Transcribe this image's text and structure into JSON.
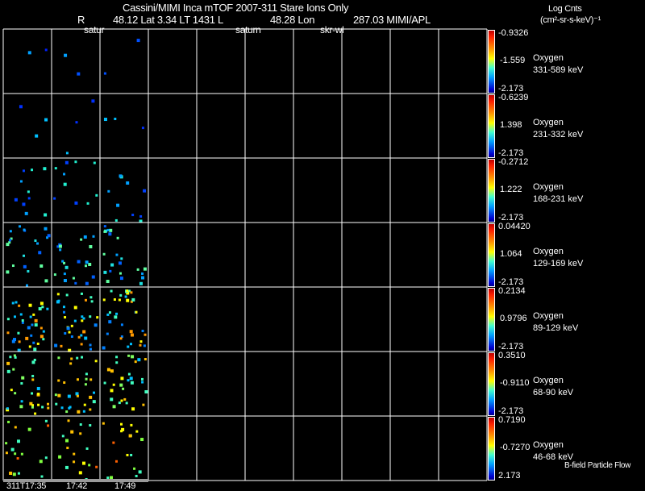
{
  "header": {
    "title": "Cassini/MIMI Inca mTOF  2007-311    Stare    Ions Only",
    "r_label": "R",
    "r_value": "48.12 Lat 3.34 LT 1431 L",
    "l_value": "48.28 Lon",
    "lon_value": "287.03  MIMI/APL",
    "markers": [
      "satur",
      "saturn",
      "skr-wl"
    ],
    "units_title": "Log Cnts",
    "units": "(cm²-sr-s-keV)⁻¹"
  },
  "chart_data": {
    "type": "heatmap",
    "title": "Cassini/MIMI Inca mTOF 2007-311 Stare Ions Only",
    "x_ticks": [
      "311T17:35",
      "17:42",
      "17:49"
    ],
    "panels": [
      {
        "species": "Oxygen",
        "energy": "331-589 keV",
        "max": "-0.9326",
        "mid": "-1.559",
        "min": "-2.173"
      },
      {
        "species": "Oxygen",
        "energy": "231-332 keV",
        "max": "-0.6239",
        "mid": "1.398",
        "min": "-2.173"
      },
      {
        "species": "Oxygen",
        "energy": "168-231 keV",
        "max": "-0.2712",
        "mid": "1.222",
        "min": "-2.173"
      },
      {
        "species": "Oxygen",
        "energy": "129-169 keV",
        "max": "0.04420",
        "mid": "1.064",
        "min": "-2.173"
      },
      {
        "species": "Oxygen",
        "energy": "89-129 keV",
        "max": "0.2134",
        "mid": "0.9796",
        "min": "-2.173"
      },
      {
        "species": "Oxygen",
        "energy": "68-90 keV",
        "max": "0.3510",
        "mid": "-0.9110",
        "min": "-2.173"
      },
      {
        "species": "Oxygen",
        "energy": "46-68 keV",
        "max": "0.7190",
        "mid": "-0.7270",
        "min": "2.173"
      }
    ],
    "columns": 10,
    "filled_columns": 3
  },
  "footer": {
    "note": "B-field Particle Flow"
  },
  "colors": {
    "grid": "#ffffff",
    "timebar": "#999999"
  }
}
